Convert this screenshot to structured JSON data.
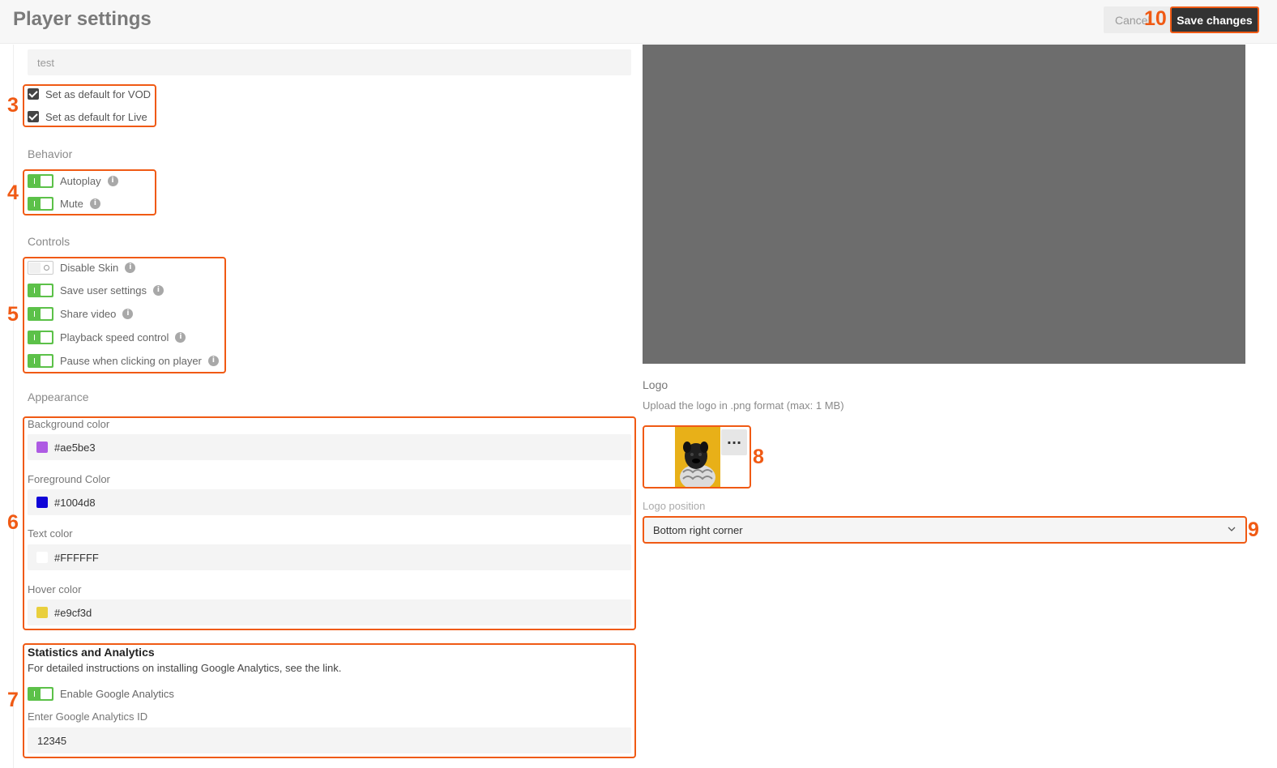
{
  "header": {
    "title": "Player settings",
    "cancel_label": "Cancel",
    "save_label": "Save changes"
  },
  "annotations": [
    "3",
    "4",
    "5",
    "6",
    "7",
    "8",
    "9",
    "10"
  ],
  "name_field": {
    "value": "test"
  },
  "defaults": [
    {
      "label": "Set as default for VOD",
      "checked": true
    },
    {
      "label": "Set as default for Live",
      "checked": true
    }
  ],
  "behavior": {
    "title": "Behavior",
    "items": [
      {
        "label": "Autoplay",
        "on": true
      },
      {
        "label": "Mute",
        "on": true
      }
    ]
  },
  "controls": {
    "title": "Controls",
    "items": [
      {
        "label": "Disable Skin",
        "on": false
      },
      {
        "label": "Save user settings",
        "on": true
      },
      {
        "label": "Share video",
        "on": true
      },
      {
        "label": "Playback speed control",
        "on": true
      },
      {
        "label": "Pause when clicking on player",
        "on": true
      }
    ]
  },
  "appearance": {
    "title": "Appearance",
    "fields": [
      {
        "label": "Background color",
        "value": "#ae5be3",
        "swatch": "#ae5be3"
      },
      {
        "label": "Foreground Color",
        "value": "#1004d8",
        "swatch": "#1004d8"
      },
      {
        "label": "Text color",
        "value": "#FFFFFF",
        "swatch": "#ffffff"
      },
      {
        "label": "Hover color",
        "value": "#e9cf3d",
        "swatch": "#e9cf3d"
      }
    ]
  },
  "stats": {
    "title": "Statistics and Analytics",
    "description": "For detailed instructions on installing Google Analytics, see the link.",
    "toggle_label": "Enable Google Analytics",
    "toggle_on": true,
    "id_label": "Enter Google Analytics ID",
    "id_value": "12345"
  },
  "logo": {
    "title": "Logo",
    "description": "Upload the logo in .png format (max: 1 MB)",
    "more_label": "···",
    "position_label": "Logo position",
    "position_value": "Bottom right corner"
  },
  "colors": {
    "accent": "#f05a14",
    "toggle_on": "#5cc149",
    "preview_bg": "#6d6d6d",
    "logo_bg": "#e8b018"
  },
  "icons": {
    "info": "info-icon",
    "chevron": "chevron-down-icon",
    "more": "more-horizontal-icon"
  }
}
